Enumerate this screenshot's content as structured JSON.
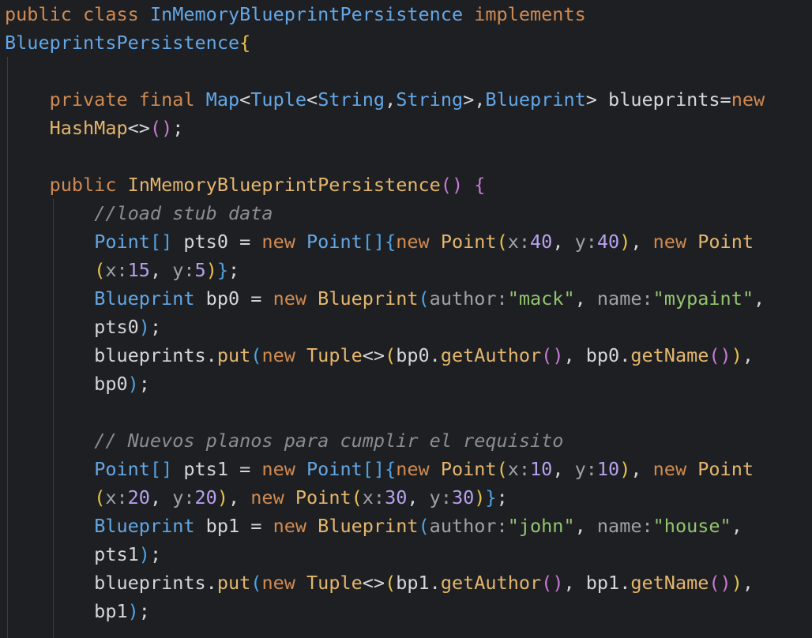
{
  "editor": {
    "lines": [
      [
        [
          "kw",
          "public class "
        ],
        [
          "type",
          "InMemoryBlueprintPersistence"
        ],
        [
          "kw",
          " implements"
        ]
      ],
      [
        [
          "type",
          "BlueprintsPersistence"
        ],
        [
          "brk1",
          "{"
        ]
      ],
      [],
      [
        [
          "plain",
          "    "
        ],
        [
          "kw",
          "private final "
        ],
        [
          "type",
          "Map"
        ],
        [
          "plain",
          "<"
        ],
        [
          "type",
          "Tuple"
        ],
        [
          "plain",
          "<"
        ],
        [
          "type",
          "String"
        ],
        [
          "plain",
          ","
        ],
        [
          "type",
          "String"
        ],
        [
          "plain",
          ">,"
        ],
        [
          "type",
          "Blueprint"
        ],
        [
          "plain",
          "> blueprints="
        ],
        [
          "kw",
          "new"
        ]
      ],
      [
        [
          "plain",
          "    "
        ],
        [
          "fn",
          "HashMap"
        ],
        [
          "plain",
          "<>"
        ],
        [
          "brk2",
          "()"
        ],
        [
          "plain",
          ";"
        ]
      ],
      [],
      [
        [
          "plain",
          "    "
        ],
        [
          "kw",
          "public "
        ],
        [
          "fn",
          "InMemoryBlueprintPersistence"
        ],
        [
          "brk2",
          "()"
        ],
        [
          "plain",
          " "
        ],
        [
          "brk2",
          "{"
        ]
      ],
      [
        [
          "plain",
          "        "
        ],
        [
          "cmt",
          "//load stub data"
        ]
      ],
      [
        [
          "plain",
          "        "
        ],
        [
          "type",
          "Point"
        ],
        [
          "brk3",
          "[]"
        ],
        [
          "plain",
          " pts0 = "
        ],
        [
          "kw",
          "new "
        ],
        [
          "type",
          "Point"
        ],
        [
          "brk3",
          "[]"
        ],
        [
          "brk3",
          "{"
        ],
        [
          "kw",
          "new "
        ],
        [
          "fn",
          "Point"
        ],
        [
          "brk1",
          "("
        ],
        [
          "hint",
          "x:"
        ],
        [
          "num",
          "40"
        ],
        [
          "plain",
          ", "
        ],
        [
          "hint",
          "y:"
        ],
        [
          "num",
          "40"
        ],
        [
          "brk1",
          ")"
        ],
        [
          "plain",
          ", "
        ],
        [
          "kw",
          "new "
        ],
        [
          "fn",
          "Point"
        ]
      ],
      [
        [
          "plain",
          "        "
        ],
        [
          "brk1",
          "("
        ],
        [
          "hint",
          "x:"
        ],
        [
          "num",
          "15"
        ],
        [
          "plain",
          ", "
        ],
        [
          "hint",
          "y:"
        ],
        [
          "num",
          "5"
        ],
        [
          "brk1",
          ")"
        ],
        [
          "brk3",
          "}"
        ],
        [
          "plain",
          ";"
        ]
      ],
      [
        [
          "plain",
          "        "
        ],
        [
          "type",
          "Blueprint"
        ],
        [
          "plain",
          " bp0 = "
        ],
        [
          "kw",
          "new "
        ],
        [
          "fn",
          "Blueprint"
        ],
        [
          "brk3",
          "("
        ],
        [
          "hint",
          "author:"
        ],
        [
          "str",
          "\"mack\""
        ],
        [
          "plain",
          ", "
        ],
        [
          "hint",
          "name:"
        ],
        [
          "str",
          "\"mypaint\""
        ],
        [
          "plain",
          ","
        ]
      ],
      [
        [
          "plain",
          "        pts0"
        ],
        [
          "brk3",
          ")"
        ],
        [
          "plain",
          ";"
        ]
      ],
      [
        [
          "plain",
          "        blueprints."
        ],
        [
          "fn",
          "put"
        ],
        [
          "brk3",
          "("
        ],
        [
          "kw",
          "new "
        ],
        [
          "fn",
          "Tuple"
        ],
        [
          "plain",
          "<>"
        ],
        [
          "brk1",
          "("
        ],
        [
          "plain",
          "bp0."
        ],
        [
          "fn",
          "getAuthor"
        ],
        [
          "brk2",
          "()"
        ],
        [
          "plain",
          ", bp0."
        ],
        [
          "fn",
          "getName"
        ],
        [
          "brk2",
          "()"
        ],
        [
          "brk1",
          ")"
        ],
        [
          "plain",
          ","
        ]
      ],
      [
        [
          "plain",
          "        bp0"
        ],
        [
          "brk3",
          ")"
        ],
        [
          "plain",
          ";"
        ]
      ],
      [],
      [
        [
          "plain",
          "        "
        ],
        [
          "cmt",
          "// Nuevos planos para cumplir el requisito"
        ]
      ],
      [
        [
          "plain",
          "        "
        ],
        [
          "type",
          "Point"
        ],
        [
          "brk3",
          "[]"
        ],
        [
          "plain",
          " pts1 = "
        ],
        [
          "kw",
          "new "
        ],
        [
          "type",
          "Point"
        ],
        [
          "brk3",
          "[]"
        ],
        [
          "brk3",
          "{"
        ],
        [
          "kw",
          "new "
        ],
        [
          "fn",
          "Point"
        ],
        [
          "brk1",
          "("
        ],
        [
          "hint",
          "x:"
        ],
        [
          "num",
          "10"
        ],
        [
          "plain",
          ", "
        ],
        [
          "hint",
          "y:"
        ],
        [
          "num",
          "10"
        ],
        [
          "brk1",
          ")"
        ],
        [
          "plain",
          ", "
        ],
        [
          "kw",
          "new "
        ],
        [
          "fn",
          "Point"
        ]
      ],
      [
        [
          "plain",
          "        "
        ],
        [
          "brk1",
          "("
        ],
        [
          "hint",
          "x:"
        ],
        [
          "num",
          "20"
        ],
        [
          "plain",
          ", "
        ],
        [
          "hint",
          "y:"
        ],
        [
          "num",
          "20"
        ],
        [
          "brk1",
          ")"
        ],
        [
          "plain",
          ", "
        ],
        [
          "kw",
          "new "
        ],
        [
          "fn",
          "Point"
        ],
        [
          "brk1",
          "("
        ],
        [
          "hint",
          "x:"
        ],
        [
          "num",
          "30"
        ],
        [
          "plain",
          ", "
        ],
        [
          "hint",
          "y:"
        ],
        [
          "num",
          "30"
        ],
        [
          "brk1",
          ")"
        ],
        [
          "brk3",
          "}"
        ],
        [
          "plain",
          ";"
        ]
      ],
      [
        [
          "plain",
          "        "
        ],
        [
          "type",
          "Blueprint"
        ],
        [
          "plain",
          " bp1 = "
        ],
        [
          "kw",
          "new "
        ],
        [
          "fn",
          "Blueprint"
        ],
        [
          "brk3",
          "("
        ],
        [
          "hint",
          "author:"
        ],
        [
          "str",
          "\"john\""
        ],
        [
          "plain",
          ", "
        ],
        [
          "hint",
          "name:"
        ],
        [
          "str",
          "\"house\""
        ],
        [
          "plain",
          ","
        ]
      ],
      [
        [
          "plain",
          "        pts1"
        ],
        [
          "brk3",
          ")"
        ],
        [
          "plain",
          ";"
        ]
      ],
      [
        [
          "plain",
          "        blueprints."
        ],
        [
          "fn",
          "put"
        ],
        [
          "brk3",
          "("
        ],
        [
          "kw",
          "new "
        ],
        [
          "fn",
          "Tuple"
        ],
        [
          "plain",
          "<>"
        ],
        [
          "brk1",
          "("
        ],
        [
          "plain",
          "bp1."
        ],
        [
          "fn",
          "getAuthor"
        ],
        [
          "brk2",
          "()"
        ],
        [
          "plain",
          ", bp1."
        ],
        [
          "fn",
          "getName"
        ],
        [
          "brk2",
          "()"
        ],
        [
          "brk1",
          ")"
        ],
        [
          "plain",
          ","
        ]
      ],
      [
        [
          "plain",
          "        bp1"
        ],
        [
          "brk3",
          ")"
        ],
        [
          "plain",
          ";"
        ]
      ]
    ]
  }
}
